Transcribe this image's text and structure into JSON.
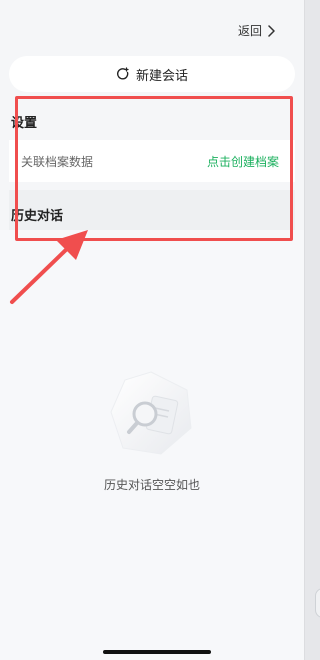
{
  "header": {
    "back_label": "返回"
  },
  "new_chat": {
    "label": "新建会话"
  },
  "settings": {
    "title": "设置",
    "row_label": "关联档案数据",
    "row_action": "点击创建档案"
  },
  "history": {
    "title": "历史对话",
    "empty_text": "历史对话空空如也"
  },
  "colors": {
    "accent_green": "#1bb05e",
    "annotation_red": "#f04e4e"
  },
  "icons": {
    "back": "chevron-right-icon",
    "new_chat": "refresh-plus-icon",
    "empty": "magnifier-document-icon"
  }
}
